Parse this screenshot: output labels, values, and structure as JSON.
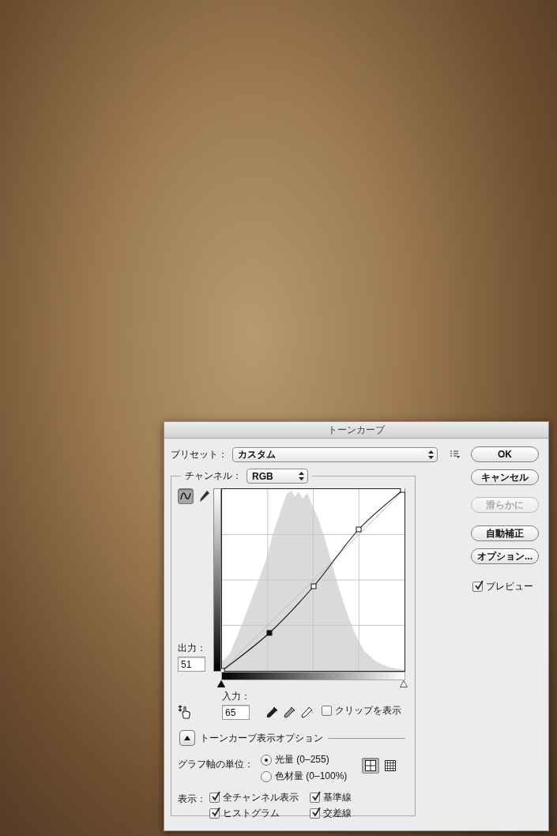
{
  "dialog": {
    "title": "トーンカーブ"
  },
  "preset": {
    "label": "プリセット：",
    "value": "カスタム"
  },
  "buttons": [
    {
      "label": "OK",
      "disabled": false
    },
    {
      "label": "キャンセル",
      "disabled": false
    },
    {
      "label": "滑らかに",
      "disabled": true
    },
    {
      "label": "自動補正",
      "disabled": false
    },
    {
      "label": "オプション...",
      "disabled": false
    }
  ],
  "preview": {
    "label": "プレビュー",
    "checked": true
  },
  "channel": {
    "label": "チャンネル：",
    "value": "RGB"
  },
  "tools": [
    {
      "kind": "curve",
      "selected": true
    },
    {
      "kind": "pencil",
      "selected": false
    }
  ],
  "output": {
    "label": "出力：",
    "value": "51"
  },
  "input": {
    "label": "入力：",
    "value": "65"
  },
  "input_sliders": [
    {
      "kind": "shadow",
      "level": 0
    },
    {
      "kind": "highlight",
      "level": 1
    }
  ],
  "clip": {
    "label": "クリップを表示",
    "checked": false
  },
  "display_options": {
    "label": "トーンカーブ表示オプション",
    "expanded": true
  },
  "axis_units": {
    "label": "グラフ軸の単位：",
    "options": [
      {
        "label": "光量 (0–255)",
        "selected": true
      },
      {
        "label": "色材量 (0–100%)",
        "selected": false
      }
    ]
  },
  "grid_sizes": [
    {
      "kind": "simple",
      "selected": true
    },
    {
      "kind": "detailed",
      "selected": false
    }
  ],
  "show": {
    "label": "表示：",
    "options": [
      {
        "kind": "channels",
        "label": "全チャンネル表示",
        "checked": true
      },
      {
        "kind": "baseline",
        "label": "基準線",
        "checked": true
      },
      {
        "kind": "histogram",
        "label": "ヒストグラム",
        "checked": true
      },
      {
        "kind": "intersection",
        "label": "交差線",
        "checked": true
      }
    ]
  }
}
